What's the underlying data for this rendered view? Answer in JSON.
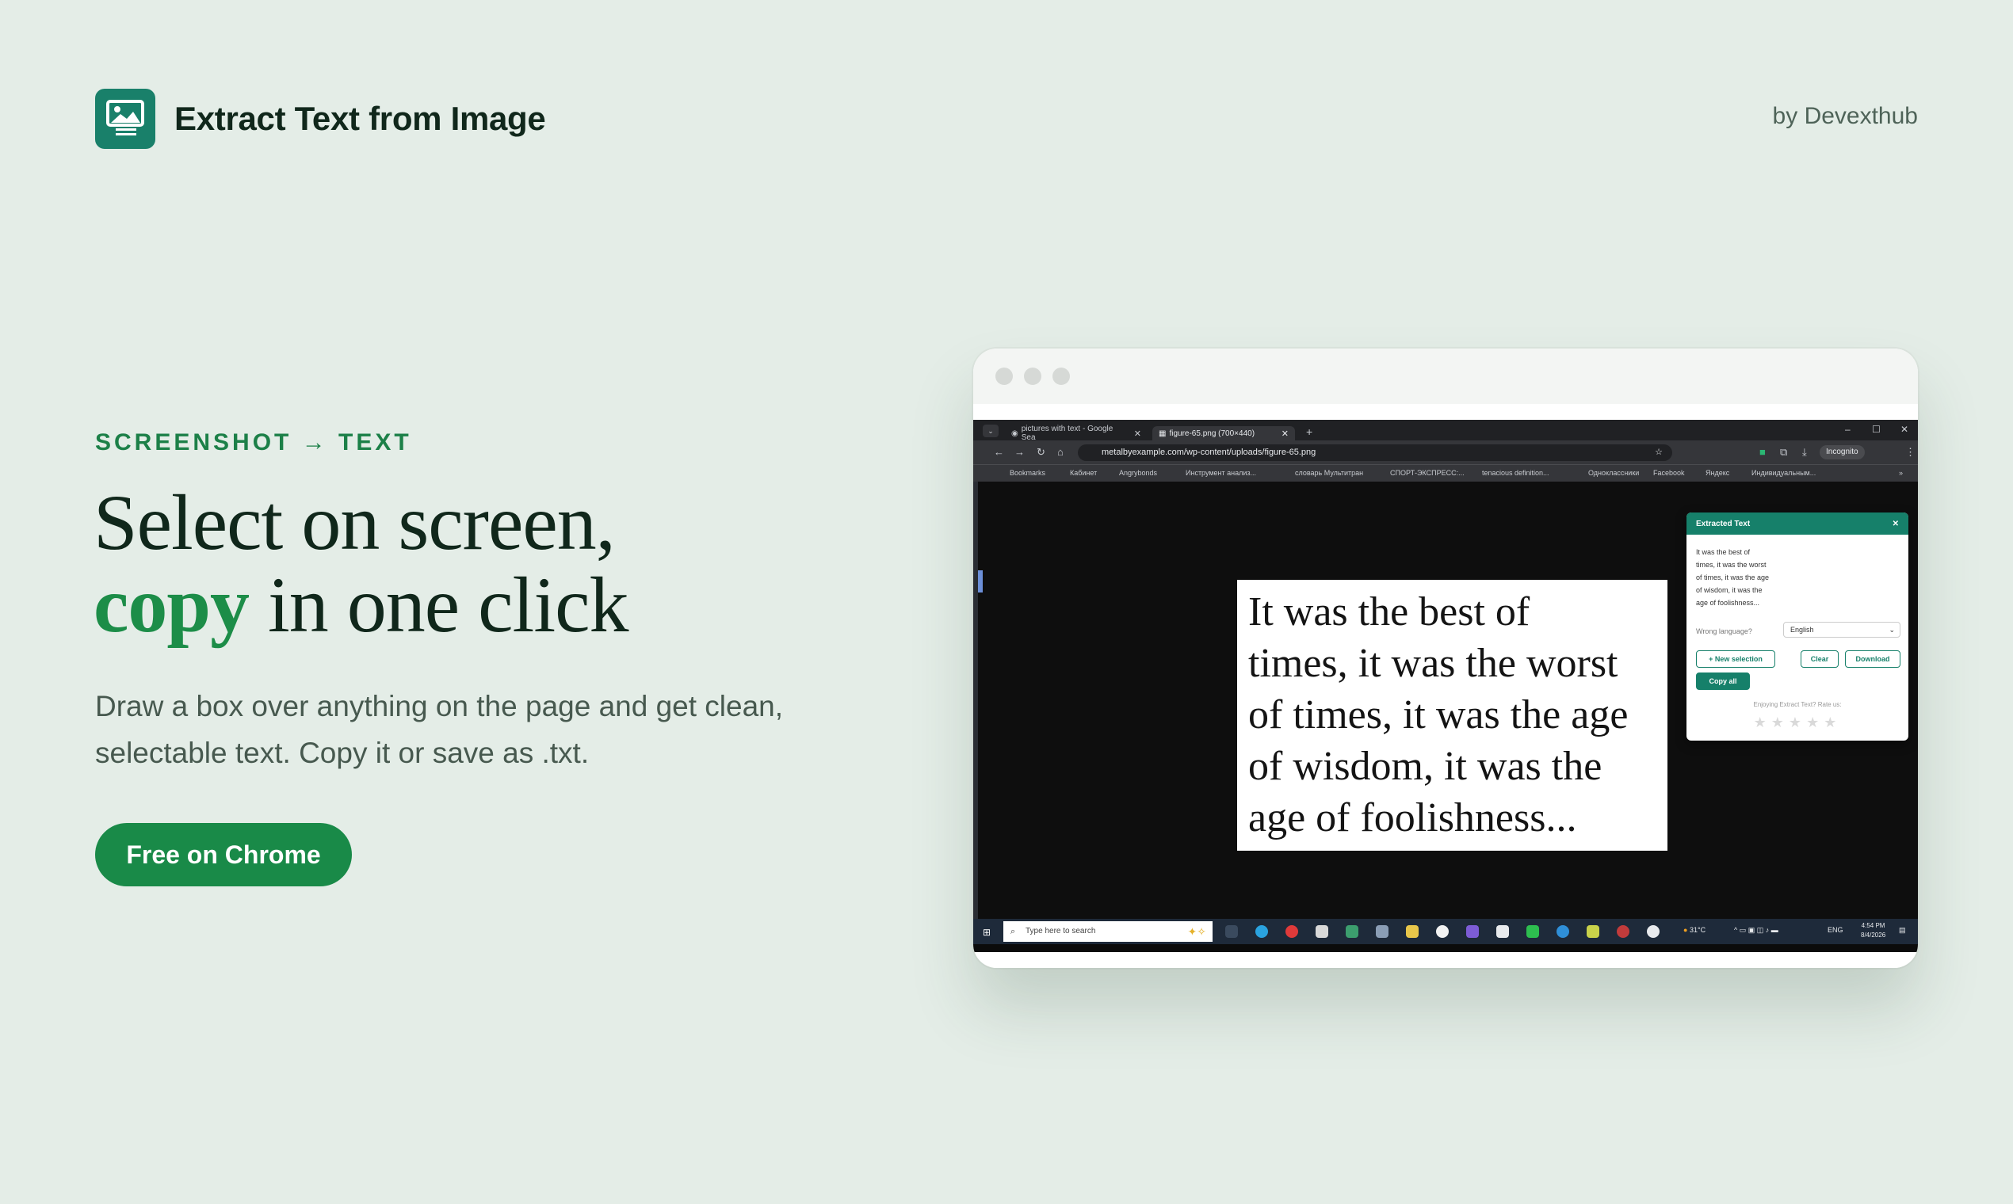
{
  "header": {
    "app_name": "Extract Text from Image",
    "byline": "by Devexthub"
  },
  "hero": {
    "eyebrow": "SCREENSHOT → TEXT",
    "headline_line1": "Select on screen,",
    "headline_accent": "copy",
    "headline_line2_rest": " in one click",
    "subtext": "Draw a box over anything on the page and get clean, selectable text. Copy it or save as .txt.",
    "cta_label": "Free on Chrome"
  },
  "colors": {
    "background": "#e4ede7",
    "accent": "#1c8d48",
    "logo": "#19806a"
  },
  "mockup": {
    "tabs": [
      {
        "title": "pictures with text - Google Sea",
        "active": false
      },
      {
        "title": "figure-65.png (700×440)",
        "active": true
      }
    ],
    "url": "metalbyexample.com/wp-content/uploads/figure-65.png",
    "incognito_label": "Incognito",
    "bookmarks": [
      "Bookmarks",
      "Кабинет",
      "Angrybonds",
      "Инструмент анализ...",
      "словарь Мультитран",
      "СПОРТ-ЭКСПРЕСС:...",
      "tenacious definition...",
      "Одноклассники",
      "Facebook",
      "Яндекс",
      "Индивидуальным..."
    ],
    "image_text_lines": [
      "It was the best of",
      "times, it was the worst",
      "of times, it was the age",
      "of wisdom, it was the",
      "age of foolishness..."
    ],
    "popup": {
      "title": "Extracted Text",
      "extracted_lines": [
        "It was the best of",
        "times, it was the worst",
        "of times, it was the age",
        "of wisdom, it was the",
        "age of foolishness..."
      ],
      "lang_label": "Wrong language?",
      "lang_value": "English",
      "new_selection": "+ New selection",
      "clear": "Clear",
      "download": "Download",
      "copy_all": "Copy all",
      "rate_prompt": "Enjoying Extract Text? Rate us:",
      "stars": "★★★★★"
    },
    "taskbar": {
      "search_placeholder": "Type here to search",
      "weather": "31°C",
      "lang": "ENG",
      "time": "4:54 PM",
      "date": "8/4/2026"
    }
  }
}
